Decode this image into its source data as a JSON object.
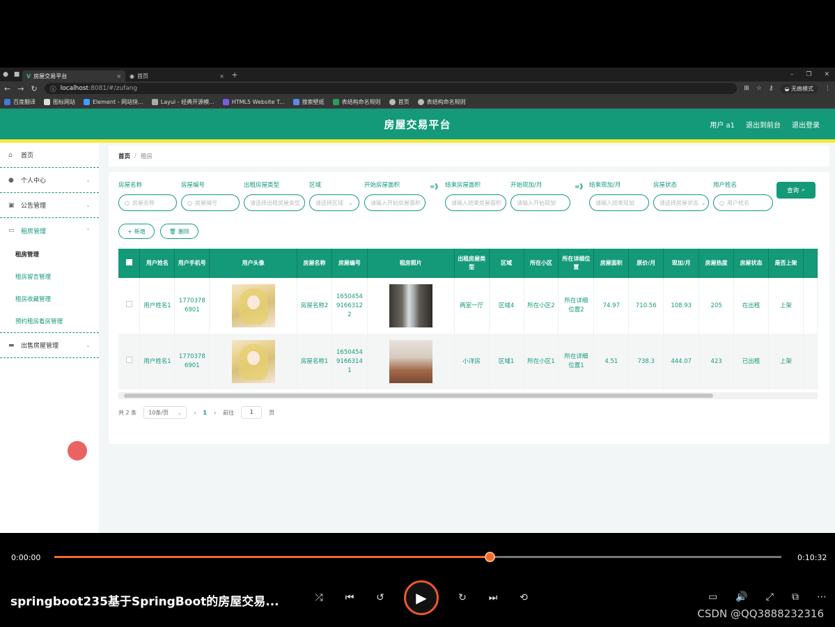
{
  "browser": {
    "tabs": [
      {
        "title": "房屋交易平台",
        "active": true
      },
      {
        "title": "首页",
        "active": false
      }
    ],
    "url_host": "localhost",
    "url_path": ":8081/#/zufang",
    "incognito_label": "无痕模式",
    "bookmarks": [
      "百度翻译",
      "图标网站",
      "Element - 网站快...",
      "Layui - 经典开源模...",
      "HTML5 Website T...",
      "搜索壁纸",
      "表结构命名规则",
      "首页",
      "表结构命名规则"
    ]
  },
  "app": {
    "title": "房屋交易平台",
    "user": "用户 a1",
    "to_front": "退出到前台",
    "logout": "退出登录"
  },
  "sidebar": {
    "items": [
      {
        "label": "首页",
        "icon": "home-icon"
      },
      {
        "label": "个人中心",
        "icon": "user-icon"
      },
      {
        "label": "公告管理",
        "icon": "notice-icon"
      },
      {
        "label": "租房管理",
        "icon": "message-icon"
      },
      {
        "label": "出售房屋管理",
        "icon": "house-icon"
      }
    ],
    "sub": [
      "租房管理",
      "租房留言管理",
      "租房收藏管理",
      "预约租房看房管理"
    ]
  },
  "breadcrumb": {
    "home": "首页",
    "sep": "/",
    "current": "租房"
  },
  "filters": {
    "labels": [
      "房屋名称",
      "房屋编号",
      "出租房屋类型",
      "区域",
      "开始房屋面积",
      "结束房屋面积",
      "开始现加/月",
      "结束现加/月",
      "房屋状态",
      "用户姓名"
    ],
    "placeholders": [
      "房屋名称",
      "房屋编号",
      "请选择出租房屋类型",
      "请选择区域",
      "请输入开始房屋面积",
      "请输入结束房屋面积",
      "请输入开始现加",
      "请输入结束现加",
      "请选择房屋状态",
      "用户姓名"
    ],
    "arrow": "=》",
    "query": "查询"
  },
  "actions": {
    "add": "新增",
    "delete": "删除"
  },
  "table": {
    "headers": [
      "用户姓名",
      "用户手机号",
      "用户头像",
      "房屋名称",
      "房屋编号",
      "租房照片",
      "出租房屋类型",
      "区域",
      "所在小区",
      "所在详细位置",
      "房屋面积",
      "原价/月",
      "现加/月",
      "房屋热度",
      "房屋状态",
      "是否上架"
    ],
    "rows": [
      {
        "user": "用户姓名1",
        "phone": "17703786901",
        "name": "房屋名称2",
        "code": "165045491663122",
        "type": "两室一厅",
        "area": "区域4",
        "community": "所在小区2",
        "detail": "所在详细位置2",
        "size": "74.97",
        "orig": "710.56",
        "now": "108.93",
        "heat": "205",
        "status": "在出租",
        "shelf": "上架"
      },
      {
        "user": "用户姓名1",
        "phone": "17703786901",
        "name": "房屋名称1",
        "code": "165045491663141",
        "type": "小洋房",
        "area": "区域1",
        "community": "所在小区1",
        "detail": "所在详细位置1",
        "size": "4.51",
        "orig": "738.3",
        "now": "444.07",
        "heat": "423",
        "status": "已出租",
        "shelf": "上架"
      }
    ]
  },
  "pager": {
    "total": "共 2 条",
    "size": "10条/页",
    "page": "1",
    "goto": "前往",
    "goto_val": "1",
    "page_unit": "页"
  },
  "player": {
    "current_time": "0:00:00",
    "total_time": "0:10:32",
    "progress": 0.6,
    "title": "springboot235基于SpringBoot的房屋交易...",
    "watermark": "CSDN @QQ3888232316"
  },
  "colors": {
    "primary": "#149979",
    "accent_yellow": "#f6ea3c",
    "player_orange": "#f26b2a"
  }
}
